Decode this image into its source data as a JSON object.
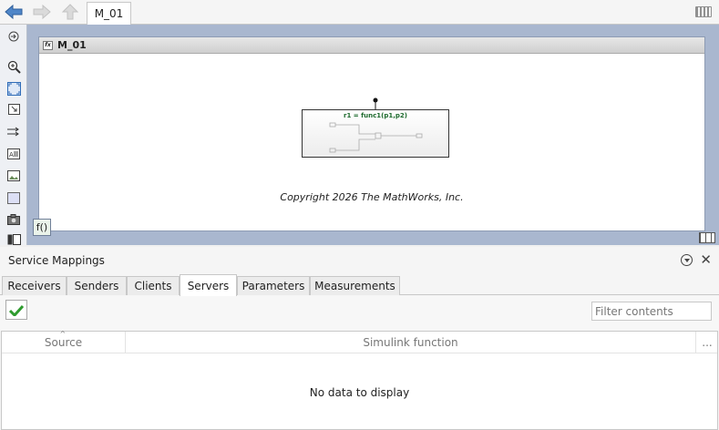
{
  "topbar": {
    "model_tab": "M_01"
  },
  "editor": {
    "frame_title": "M_01",
    "block_label": "r1 = func1(p1,p2)",
    "copyright": "Copyright 2026 The MathWorks, Inc.",
    "function_button": "f()"
  },
  "panel": {
    "title": "Service Mappings",
    "tabs": [
      {
        "label": "Receivers"
      },
      {
        "label": "Senders"
      },
      {
        "label": "Clients"
      },
      {
        "label": "Servers"
      },
      {
        "label": "Parameters"
      },
      {
        "label": "Measurements"
      }
    ],
    "active_tab": "Servers",
    "filter_placeholder": "Filter contents",
    "columns": [
      "Source",
      "Simulink function"
    ],
    "more_columns": "...",
    "empty_text": "No data to display"
  },
  "colors": {
    "canvas": "#a9b7cf",
    "block_label": "#1e6b2e",
    "check": "#2e9b2e"
  }
}
